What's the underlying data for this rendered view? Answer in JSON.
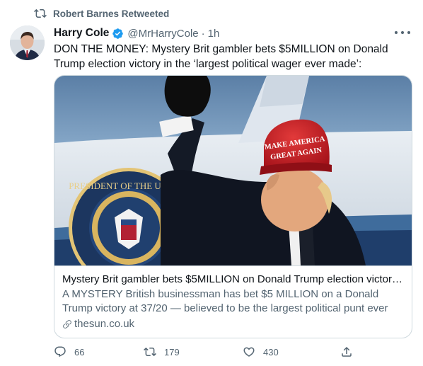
{
  "retweet": {
    "text": "Robert Barnes Retweeted"
  },
  "tweet": {
    "author_name": "Harry Cole",
    "handle": "@MrHarryCole",
    "separator": "·",
    "time": "1h",
    "text": "DON THE MONEY: Mystery Brit gambler bets $5MILLION on Donald Trump election victory in the ‘largest political wager ever made’:"
  },
  "card": {
    "hat_line1": "MAKE AMERICA",
    "hat_line2": "GREAT AGAIN",
    "seal_text": "PRESIDENT OF THE UNITED",
    "title": "Mystery Brit gambler bets $5MILLION on Donald Trump election victory ...",
    "description": "A MYSTERY British businessman has bet $5 MILLION on a Donald Trump victory at 37/20 — believed to be the largest political punt ever made. ...",
    "domain": "thesun.co.uk"
  },
  "actions": {
    "reply_count": "66",
    "retweet_count": "179",
    "like_count": "430"
  },
  "colors": {
    "verified": "#1d9bf0",
    "secondary_text": "#536471",
    "border": "#cfd9de"
  },
  "icons": [
    "retweet-icon",
    "verified-badge-icon",
    "more-icon",
    "link-icon",
    "reply-icon",
    "retweet-icon",
    "like-icon",
    "share-icon"
  ]
}
